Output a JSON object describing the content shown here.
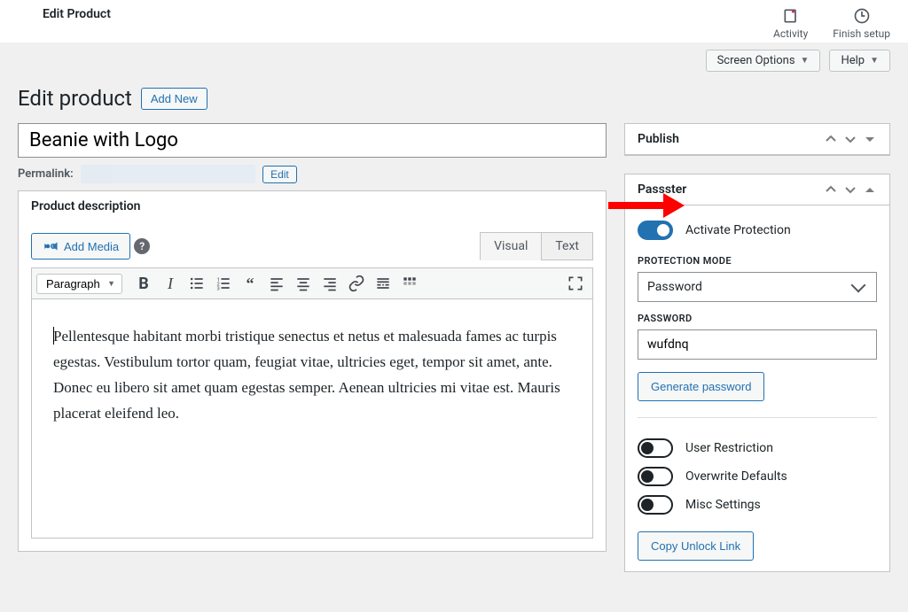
{
  "topBar": {
    "title": "Edit Product",
    "items": [
      {
        "label": "Activity"
      },
      {
        "label": "Finish setup"
      }
    ]
  },
  "optionTabs": {
    "screen": "Screen Options",
    "help": "Help"
  },
  "page": {
    "title": "Edit product",
    "addNew": "Add New",
    "productTitle": "Beanie with Logo"
  },
  "permalink": {
    "label": "Permalink:",
    "editBtn": "Edit"
  },
  "editor": {
    "title": "Product description",
    "addMedia": "Add Media",
    "tabVisual": "Visual",
    "tabText": "Text",
    "paragraphLabel": "Paragraph",
    "content": "Pellentesque habitant morbi tristique senectus et netus et malesuada fames ac turpis egestas. Vestibulum tortor quam, feugiat vitae, ultricies eget, tempor sit amet, ante. Donec eu libero sit amet quam egestas semper. Aenean ultricies mi vitae est. Mauris placerat eleifend leo."
  },
  "sidebar": {
    "publish": {
      "title": "Publish"
    },
    "passster": {
      "title": "Passster",
      "activate": "Activate Protection",
      "protectionModeLabel": "PROTECTION MODE",
      "protectionModeValue": "Password",
      "passwordLabel": "PASSWORD",
      "passwordValue": "wufdnq",
      "generateBtn": "Generate password",
      "userRestriction": "User Restriction",
      "overwriteDefaults": "Overwrite Defaults",
      "miscSettings": "Misc Settings",
      "copyLinkBtn": "Copy Unlock Link"
    }
  }
}
